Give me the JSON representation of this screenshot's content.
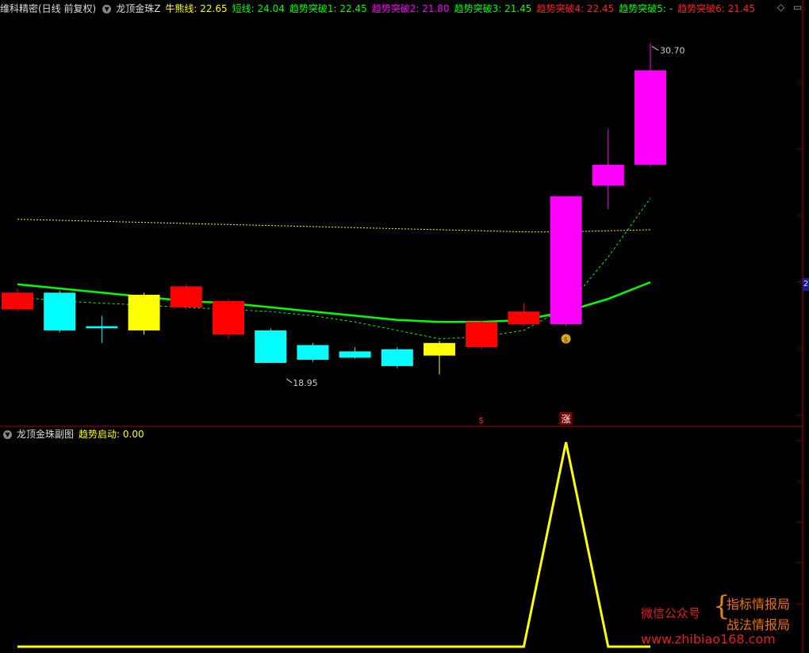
{
  "main_panel": {
    "stock_title": "维科精密(日线 前复权)",
    "indicator_name": "龙顶金珠Z",
    "legend": [
      {
        "label": "牛熊线: ",
        "value": "22.65",
        "color": "#ffff00"
      },
      {
        "label": "短线: ",
        "value": "24.04",
        "color": "#00ff00"
      },
      {
        "label": "趋势突破1: ",
        "value": "22.45",
        "color": "#00ff00"
      },
      {
        "label": "趋势突破2: ",
        "value": "21.80",
        "color": "#ff00ff"
      },
      {
        "label": "趋势突破3: ",
        "value": "21.45",
        "color": "#00ff00"
      },
      {
        "label": "趋势突破4: ",
        "value": "22.45",
        "color": "#ff2020"
      },
      {
        "label": "趋势突破5: ",
        "value": "-",
        "color": "#00ff00"
      },
      {
        "label": "趋势突破6: ",
        "value": "21.45",
        "color": "#ff2020"
      }
    ],
    "high_label": "30.70",
    "low_label": "18.95",
    "signal_mark_1": "$",
    "signal_mark_2": "涨",
    "money_icon": "money-bag-icon",
    "right_axis_tag": "2"
  },
  "sub_panel": {
    "indicator_name": "龙顶金珠副图",
    "legend": [
      {
        "label": "趋势启动: ",
        "value": "0.00",
        "color": "#ffff00"
      }
    ]
  },
  "watermark": {
    "wechat": "微信公众号",
    "line1": "指标情报局",
    "line2": "战法情报局",
    "url": "www.zhibiao168.com"
  },
  "colors": {
    "up": "#ff0000",
    "down": "#00ffff",
    "doji_yellow": "#ffff00",
    "surge": "#ff00ff",
    "bull_bear_line": "#ffff00",
    "short_line": "#00ff00",
    "grid": "#7a0000",
    "sub_line": "#ffff00"
  },
  "chart_data": {
    "type": "candlestick",
    "candles": [
      {
        "open": 21.5,
        "close": 22.3,
        "high": 22.5,
        "low": 21.4,
        "color": "up"
      },
      {
        "open": 22.3,
        "close": 20.5,
        "high": 22.4,
        "low": 20.4,
        "color": "down"
      },
      {
        "open": 20.7,
        "close": 20.6,
        "high": 21.2,
        "low": 19.9,
        "color": "down"
      },
      {
        "open": 20.5,
        "close": 22.2,
        "high": 22.3,
        "low": 20.3,
        "color": "doji_yellow"
      },
      {
        "open": 21.6,
        "close": 22.6,
        "high": 22.7,
        "low": 21.5,
        "color": "up"
      },
      {
        "open": 20.3,
        "close": 21.9,
        "high": 22.0,
        "low": 20.1,
        "color": "up"
      },
      {
        "open": 20.5,
        "close": 18.95,
        "high": 20.6,
        "low": 18.95,
        "color": "down"
      },
      {
        "open": 19.8,
        "close": 19.1,
        "high": 19.9,
        "low": 19.0,
        "color": "down"
      },
      {
        "open": 19.5,
        "close": 19.2,
        "high": 19.7,
        "low": 19.15,
        "color": "down"
      },
      {
        "open": 19.6,
        "close": 18.8,
        "high": 19.7,
        "low": 18.7,
        "color": "down"
      },
      {
        "open": 19.9,
        "close": 19.3,
        "high": 20.0,
        "low": 18.4,
        "color": "doji_yellow"
      },
      {
        "open": 19.7,
        "close": 20.9,
        "high": 21.0,
        "low": 19.6,
        "color": "up"
      },
      {
        "open": 20.8,
        "close": 21.4,
        "high": 21.8,
        "low": 20.7,
        "color": "up"
      },
      {
        "open": 20.8,
        "close": 26.9,
        "high": 26.9,
        "low": 20.7,
        "color": "surge"
      },
      {
        "open": 28.4,
        "close": 27.4,
        "high": 30.1,
        "low": 26.3,
        "color": "surge"
      },
      {
        "open": 28.4,
        "close": 32.9,
        "high": 34.2,
        "low": 28.3,
        "color": "surge"
      }
    ],
    "bull_bear_line": [
      25.8,
      25.75,
      25.7,
      25.65,
      25.6,
      25.55,
      25.5,
      25.45,
      25.4,
      25.35,
      25.3,
      25.25,
      25.2,
      25.2,
      25.25,
      25.3
    ],
    "short_line": [
      22.7,
      22.5,
      22.3,
      22.1,
      21.9,
      21.8,
      21.6,
      21.4,
      21.2,
      21.0,
      20.9,
      20.9,
      21.0,
      21.4,
      22.0,
      22.8
    ],
    "trend_line_dashed": [
      22.1,
      21.9,
      21.8,
      21.7,
      21.6,
      21.5,
      21.4,
      21.2,
      20.9,
      20.5,
      20.1,
      20.2,
      20.5,
      21.6,
      24.0,
      26.8
    ],
    "ylim": [
      16.0,
      35.5
    ],
    "sub_chart": {
      "type": "line",
      "name": "趋势启动",
      "values": [
        0,
        0,
        0,
        0,
        0,
        0,
        0,
        0,
        0,
        0,
        0,
        0,
        0,
        1,
        0,
        0
      ]
    }
  }
}
